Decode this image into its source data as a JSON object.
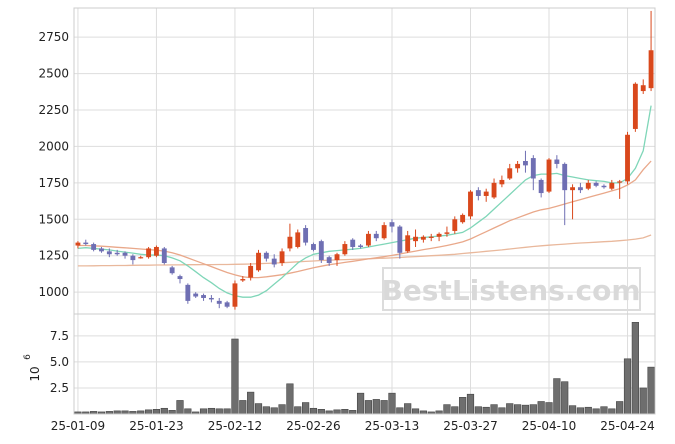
{
  "chart_data": {
    "type": "candlestick",
    "watermark": "BestListens.com",
    "colors": {
      "up": "#d9481c",
      "down": "#6f6fb3",
      "ma_fast": "#7fd6b8",
      "ma_mid": "#e9a88a",
      "ma_slow": "#e9b89c",
      "volume": "#6e6e6e",
      "grid": "#dddddd"
    },
    "price_axis": {
      "ylim": [
        850,
        2950
      ],
      "ticks": [
        1000,
        1250,
        1500,
        1750,
        2000,
        2250,
        2500,
        2750
      ]
    },
    "volume_axis": {
      "ylim": [
        0,
        9.6
      ],
      "ticks": [
        2.5,
        5.0,
        7.5
      ],
      "tick_labels": [
        "2.5",
        "5.0",
        "7.5"
      ],
      "multiplier_label": "10",
      "multiplier_exp": "6"
    },
    "x_ticks": [
      {
        "index": 0,
        "label": "25-01-09"
      },
      {
        "index": 10,
        "label": "25-01-23"
      },
      {
        "index": 20,
        "label": "25-02-12"
      },
      {
        "index": 30,
        "label": "25-02-26"
      },
      {
        "index": 40,
        "label": "25-03-13"
      },
      {
        "index": 50,
        "label": "25-03-27"
      },
      {
        "index": 60,
        "label": "25-04-10"
      },
      {
        "index": 70,
        "label": "25-04-24"
      }
    ],
    "candles": [
      [
        1320,
        1350,
        1300,
        1340
      ],
      [
        1340,
        1360,
        1320,
        1330
      ],
      [
        1330,
        1340,
        1280,
        1290
      ],
      [
        1300,
        1310,
        1270,
        1280
      ],
      [
        1280,
        1300,
        1240,
        1260
      ],
      [
        1270,
        1290,
        1250,
        1260
      ],
      [
        1270,
        1280,
        1230,
        1250
      ],
      [
        1250,
        1260,
        1190,
        1220
      ],
      [
        1240,
        1250,
        1230,
        1240
      ],
      [
        1240,
        1310,
        1230,
        1300
      ],
      [
        1250,
        1320,
        1240,
        1310
      ],
      [
        1300,
        1310,
        1190,
        1200
      ],
      [
        1170,
        1180,
        1120,
        1130
      ],
      [
        1110,
        1120,
        1060,
        1090
      ],
      [
        1050,
        1060,
        920,
        940
      ],
      [
        990,
        1000,
        960,
        970
      ],
      [
        980,
        990,
        940,
        960
      ],
      [
        960,
        980,
        930,
        950
      ],
      [
        940,
        960,
        890,
        920
      ],
      [
        930,
        940,
        890,
        900
      ],
      [
        900,
        1080,
        880,
        1060
      ],
      [
        1080,
        1110,
        1070,
        1090
      ],
      [
        1100,
        1200,
        1080,
        1180
      ],
      [
        1150,
        1290,
        1140,
        1270
      ],
      [
        1270,
        1280,
        1210,
        1230
      ],
      [
        1230,
        1260,
        1170,
        1190
      ],
      [
        1200,
        1300,
        1180,
        1280
      ],
      [
        1300,
        1470,
        1280,
        1380
      ],
      [
        1310,
        1430,
        1300,
        1410
      ],
      [
        1440,
        1460,
        1320,
        1340
      ],
      [
        1330,
        1340,
        1280,
        1290
      ],
      [
        1350,
        1360,
        1200,
        1220
      ],
      [
        1240,
        1250,
        1180,
        1200
      ],
      [
        1220,
        1270,
        1180,
        1260
      ],
      [
        1260,
        1350,
        1250,
        1330
      ],
      [
        1360,
        1370,
        1290,
        1310
      ],
      [
        1320,
        1330,
        1300,
        1310
      ],
      [
        1320,
        1420,
        1310,
        1400
      ],
      [
        1400,
        1420,
        1350,
        1370
      ],
      [
        1370,
        1480,
        1360,
        1460
      ],
      [
        1480,
        1500,
        1410,
        1450
      ],
      [
        1450,
        1460,
        1230,
        1270
      ],
      [
        1280,
        1420,
        1270,
        1390
      ],
      [
        1350,
        1430,
        1310,
        1380
      ],
      [
        1360,
        1390,
        1340,
        1380
      ],
      [
        1380,
        1400,
        1350,
        1380
      ],
      [
        1380,
        1410,
        1350,
        1400
      ],
      [
        1400,
        1450,
        1380,
        1410
      ],
      [
        1420,
        1520,
        1400,
        1500
      ],
      [
        1480,
        1540,
        1470,
        1530
      ],
      [
        1520,
        1700,
        1500,
        1690
      ],
      [
        1700,
        1720,
        1630,
        1660
      ],
      [
        1660,
        1710,
        1620,
        1690
      ],
      [
        1650,
        1780,
        1640,
        1750
      ],
      [
        1740,
        1800,
        1720,
        1770
      ],
      [
        1780,
        1880,
        1770,
        1850
      ],
      [
        1850,
        1900,
        1820,
        1880
      ],
      [
        1900,
        1970,
        1820,
        1870
      ],
      [
        1920,
        1940,
        1700,
        1780
      ],
      [
        1770,
        1780,
        1650,
        1680
      ],
      [
        1690,
        1920,
        1680,
        1910
      ],
      [
        1910,
        1940,
        1850,
        1880
      ],
      [
        1880,
        1890,
        1460,
        1700
      ],
      [
        1700,
        1740,
        1500,
        1720
      ],
      [
        1720,
        1750,
        1680,
        1700
      ],
      [
        1710,
        1770,
        1700,
        1750
      ],
      [
        1750,
        1760,
        1720,
        1730
      ],
      [
        1730,
        1740,
        1710,
        1720
      ],
      [
        1710,
        1770,
        1700,
        1750
      ],
      [
        1760,
        1770,
        1640,
        1760
      ],
      [
        1760,
        2100,
        1740,
        2080
      ],
      [
        2120,
        2440,
        2100,
        2430
      ],
      [
        2380,
        2460,
        2360,
        2420
      ],
      [
        2400,
        2930,
        2380,
        2660
      ]
    ],
    "ma_fast": [
      1300,
      1305,
      1300,
      1295,
      1290,
      1282,
      1275,
      1268,
      1260,
      1255,
      1255,
      1250,
      1235,
      1215,
      1180,
      1140,
      1100,
      1065,
      1025,
      995,
      975,
      965,
      965,
      980,
      1010,
      1055,
      1100,
      1150,
      1200,
      1235,
      1260,
      1270,
      1280,
      1285,
      1290,
      1295,
      1300,
      1310,
      1320,
      1330,
      1340,
      1350,
      1360,
      1370,
      1375,
      1380,
      1385,
      1390,
      1400,
      1410,
      1440,
      1480,
      1520,
      1570,
      1620,
      1670,
      1720,
      1770,
      1800,
      1810,
      1810,
      1815,
      1800,
      1790,
      1780,
      1770,
      1765,
      1760,
      1750,
      1750,
      1780,
      1850,
      1970,
      2280
    ],
    "ma_mid": [
      1320,
      1320,
      1318,
      1315,
      1312,
      1308,
      1304,
      1300,
      1296,
      1292,
      1288,
      1282,
      1270,
      1255,
      1235,
      1215,
      1195,
      1175,
      1155,
      1135,
      1118,
      1105,
      1100,
      1100,
      1105,
      1112,
      1120,
      1130,
      1142,
      1155,
      1168,
      1178,
      1188,
      1196,
      1204,
      1212,
      1220,
      1228,
      1236,
      1244,
      1252,
      1262,
      1272,
      1282,
      1292,
      1300,
      1310,
      1320,
      1332,
      1345,
      1365,
      1390,
      1415,
      1440,
      1465,
      1490,
      1510,
      1530,
      1550,
      1565,
      1575,
      1590,
      1605,
      1620,
      1635,
      1650,
      1665,
      1680,
      1695,
      1710,
      1735,
      1770,
      1840,
      1900
    ],
    "ma_slow": [
      1180,
      1180,
      1181,
      1182,
      1182,
      1183,
      1183,
      1184,
      1185,
      1185,
      1186,
      1186,
      1187,
      1187,
      1188,
      1188,
      1189,
      1189,
      1190,
      1190,
      1191,
      1192,
      1193,
      1195,
      1197,
      1199,
      1202,
      1205,
      1208,
      1211,
      1214,
      1217,
      1219,
      1221,
      1223,
      1225,
      1227,
      1229,
      1231,
      1233,
      1235,
      1238,
      1241,
      1244,
      1247,
      1250,
      1253,
      1256,
      1260,
      1265,
      1270,
      1275,
      1280,
      1285,
      1290,
      1296,
      1302,
      1308,
      1313,
      1318,
      1322,
      1326,
      1330,
      1334,
      1337,
      1340,
      1343,
      1346,
      1349,
      1353,
      1358,
      1364,
      1372,
      1392
    ],
    "volume": [
      0.2,
      0.2,
      0.25,
      0.2,
      0.25,
      0.3,
      0.3,
      0.25,
      0.3,
      0.4,
      0.45,
      0.55,
      0.35,
      1.3,
      0.5,
      0.2,
      0.5,
      0.55,
      0.5,
      0.5,
      7.2,
      1.3,
      2.1,
      1.0,
      0.7,
      0.6,
      0.9,
      2.9,
      0.7,
      1.1,
      0.55,
      0.45,
      0.3,
      0.4,
      0.45,
      0.35,
      2.0,
      1.3,
      1.4,
      1.3,
      2.0,
      0.6,
      1.0,
      0.5,
      0.3,
      0.2,
      0.3,
      0.9,
      0.7,
      1.6,
      1.9,
      0.7,
      0.65,
      0.9,
      0.6,
      1.0,
      0.9,
      0.85,
      0.9,
      1.2,
      1.1,
      3.4,
      3.1,
      0.8,
      0.6,
      0.65,
      0.5,
      0.7,
      0.5,
      1.2,
      5.3,
      8.8,
      2.5,
      4.5
    ]
  }
}
